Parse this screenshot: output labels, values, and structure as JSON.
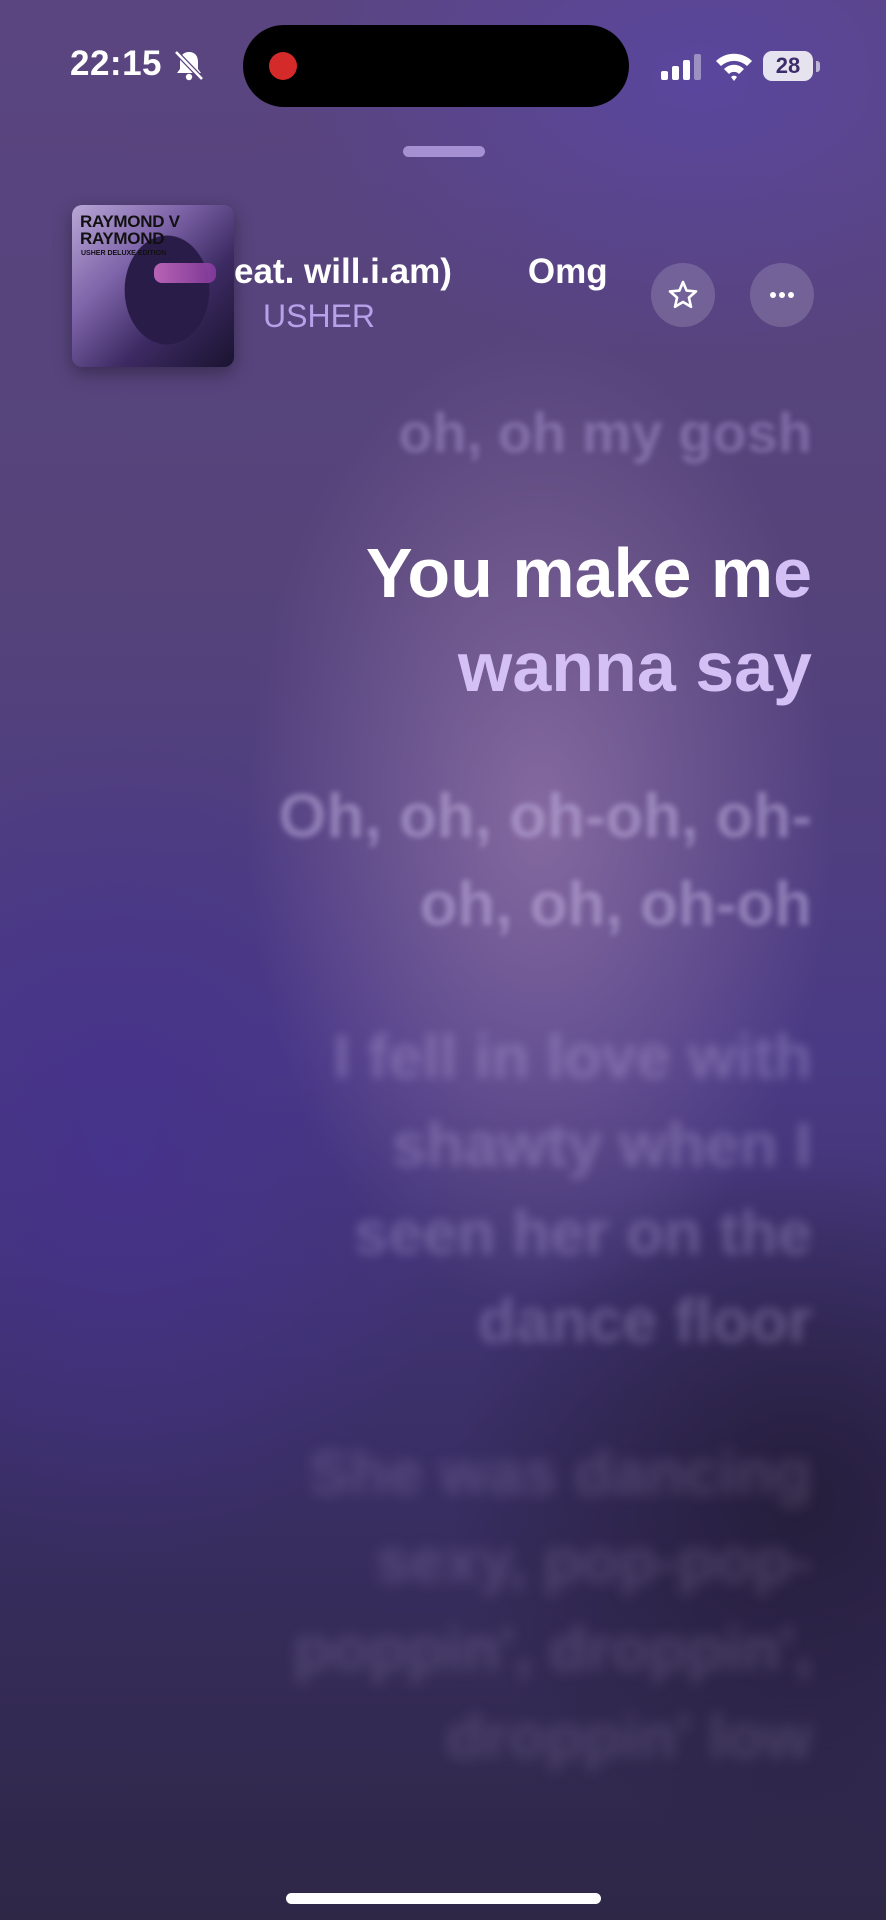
{
  "status_bar": {
    "time": "22:15",
    "battery": "28",
    "icons": [
      "bell-slash-icon",
      "cellular-signal-icon",
      "wifi-icon",
      "battery-icon"
    ],
    "recording_color": "#d42a2a"
  },
  "now_playing": {
    "album_art_text": {
      "title_line1": "RAYMOND V",
      "title_line2": "RAYMOND",
      "subtitle": "USHER DELUXE EDITION"
    },
    "title_fragment": "eat. will.i.am)",
    "title_fragment_2": "Omg",
    "artist": "USHER",
    "favorite_icon": "star-icon",
    "more_icon": "ellipsis-icon"
  },
  "lyrics": {
    "prev_line": "oh, oh my gosh",
    "current_line_1_bright": "You make m",
    "current_line_1_dim": "e",
    "current_line_2": "wanna say",
    "next_1_line_1": "Oh, oh, oh-oh, oh-",
    "next_1_line_2": "oh, oh, oh-oh",
    "next_2_line_1": "I fell in love with",
    "next_2_line_2": "shawty when I",
    "next_2_line_3": "seen her on the",
    "next_2_line_4": "dance floor",
    "next_3_line_1": "She was dancing",
    "next_3_line_2": "sexy, pop-pop-",
    "next_3_line_3": "poppin', droppin',",
    "next_3_line_4": "droppin' low"
  },
  "colors": {
    "accent": "#b9a0ea",
    "lyric_active": "#ffffff",
    "lyric_upcoming": "#d4c0f5"
  }
}
